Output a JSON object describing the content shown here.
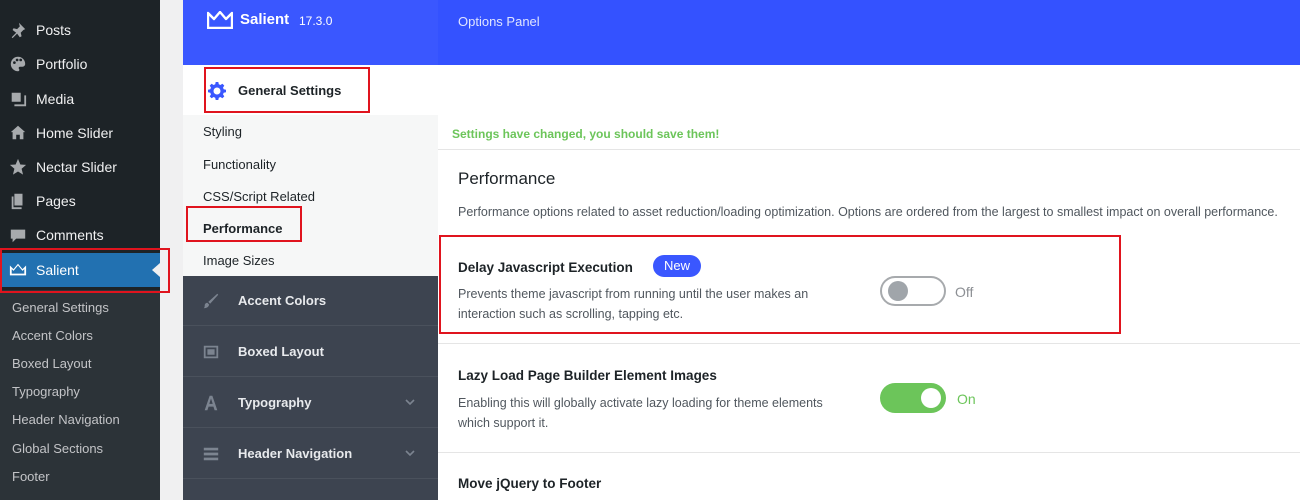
{
  "wp_menu": {
    "items": [
      {
        "label": "Posts",
        "icon": "pin-icon"
      },
      {
        "label": "Portfolio",
        "icon": "palette-icon"
      },
      {
        "label": "Media",
        "icon": "media-icon"
      },
      {
        "label": "Home Slider",
        "icon": "home-icon"
      },
      {
        "label": "Nectar Slider",
        "icon": "star-icon"
      },
      {
        "label": "Pages",
        "icon": "pages-icon"
      },
      {
        "label": "Comments",
        "icon": "comment-icon"
      },
      {
        "label": "Salient",
        "icon": "crown-icon"
      }
    ],
    "submenu": [
      "General Settings",
      "Accent Colors",
      "Boxed Layout",
      "Typography",
      "Header Navigation",
      "Global Sections",
      "Footer"
    ]
  },
  "header": {
    "brand": "Salient",
    "version": "17.3.0",
    "panel_title": "Options Panel",
    "colors": {
      "header": "#3452ff",
      "accent": "#3a57ff"
    }
  },
  "nav": {
    "section": "General Settings",
    "links": [
      "Styling",
      "Functionality",
      "CSS/Script Related",
      "Performance",
      "Image Sizes"
    ],
    "dark_sections": [
      {
        "label": "Accent Colors",
        "icon": "brush-icon"
      },
      {
        "label": "Boxed Layout",
        "icon": "boxed-layout-icon"
      },
      {
        "label": "Typography",
        "icon": "typography-icon"
      },
      {
        "label": "Header Navigation",
        "icon": "menu-lines-icon"
      }
    ]
  },
  "main": {
    "notice": "Settings have changed, you should save them!",
    "section_title": "Performance",
    "section_desc": "Performance options related to asset reduction/loading optimization. Options are ordered from the largest to smallest impact on overall performance.",
    "options": [
      {
        "title": "Delay Javascript Execution",
        "badge": "New",
        "desc": "Prevents theme javascript from running until the user makes an interaction such as scrolling, tapping etc.",
        "state": "Off"
      },
      {
        "title": "Lazy Load Page Builder Element Images",
        "desc": "Enabling this will globally activate lazy loading for theme elements which support it.",
        "state": "On"
      },
      {
        "title": "Move jQuery to Footer"
      }
    ]
  }
}
